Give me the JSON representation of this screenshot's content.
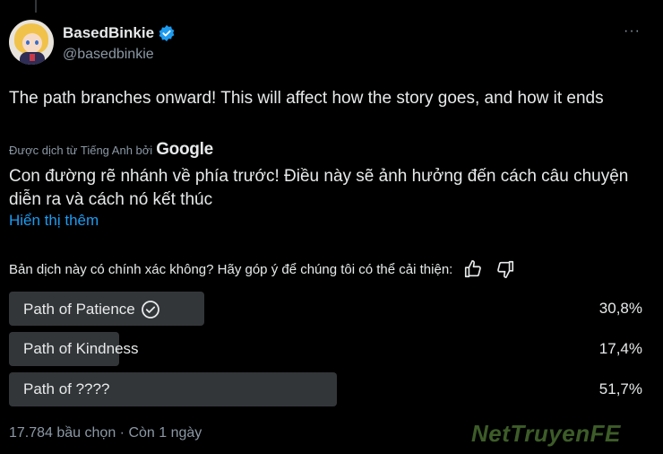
{
  "author": {
    "display_name": "BasedBinkie",
    "handle": "@basedbinkie",
    "more_label": "···"
  },
  "tweet": {
    "text": "The path branches onward! This will affect how the story goes, and how it ends",
    "translated_by": "Được dịch từ Tiếng Anh bởi",
    "translator": "Google",
    "translation": "Con đường rẽ nhánh về phía trước! Điều này sẽ ảnh hưởng đến cách câu chuyện diễn ra và cách nó kết thúc",
    "show_more": "Hiển thị thêm"
  },
  "feedback": {
    "question": "Bản dịch này có chính xác không? Hãy góp ý để chúng tôi có thể cải thiện:"
  },
  "poll": {
    "options": [
      {
        "label": "Path of Patience",
        "percent_text": "30,8%",
        "percent": 30.8,
        "selected": true
      },
      {
        "label": "Path of Kindness",
        "percent_text": "17,4%",
        "percent": 17.4,
        "selected": false
      },
      {
        "label": "Path of ????",
        "percent_text": "51,7%",
        "percent": 51.7,
        "selected": false
      }
    ],
    "meta": "17.784 bầu chọn · Còn 1 ngày"
  },
  "watermark": "NetTruyenFE",
  "colors": {
    "background": "#000000",
    "text": "#e7e9ea",
    "secondary": "#8b98a5",
    "accent": "#1d9bf0",
    "bar": "#333639"
  }
}
